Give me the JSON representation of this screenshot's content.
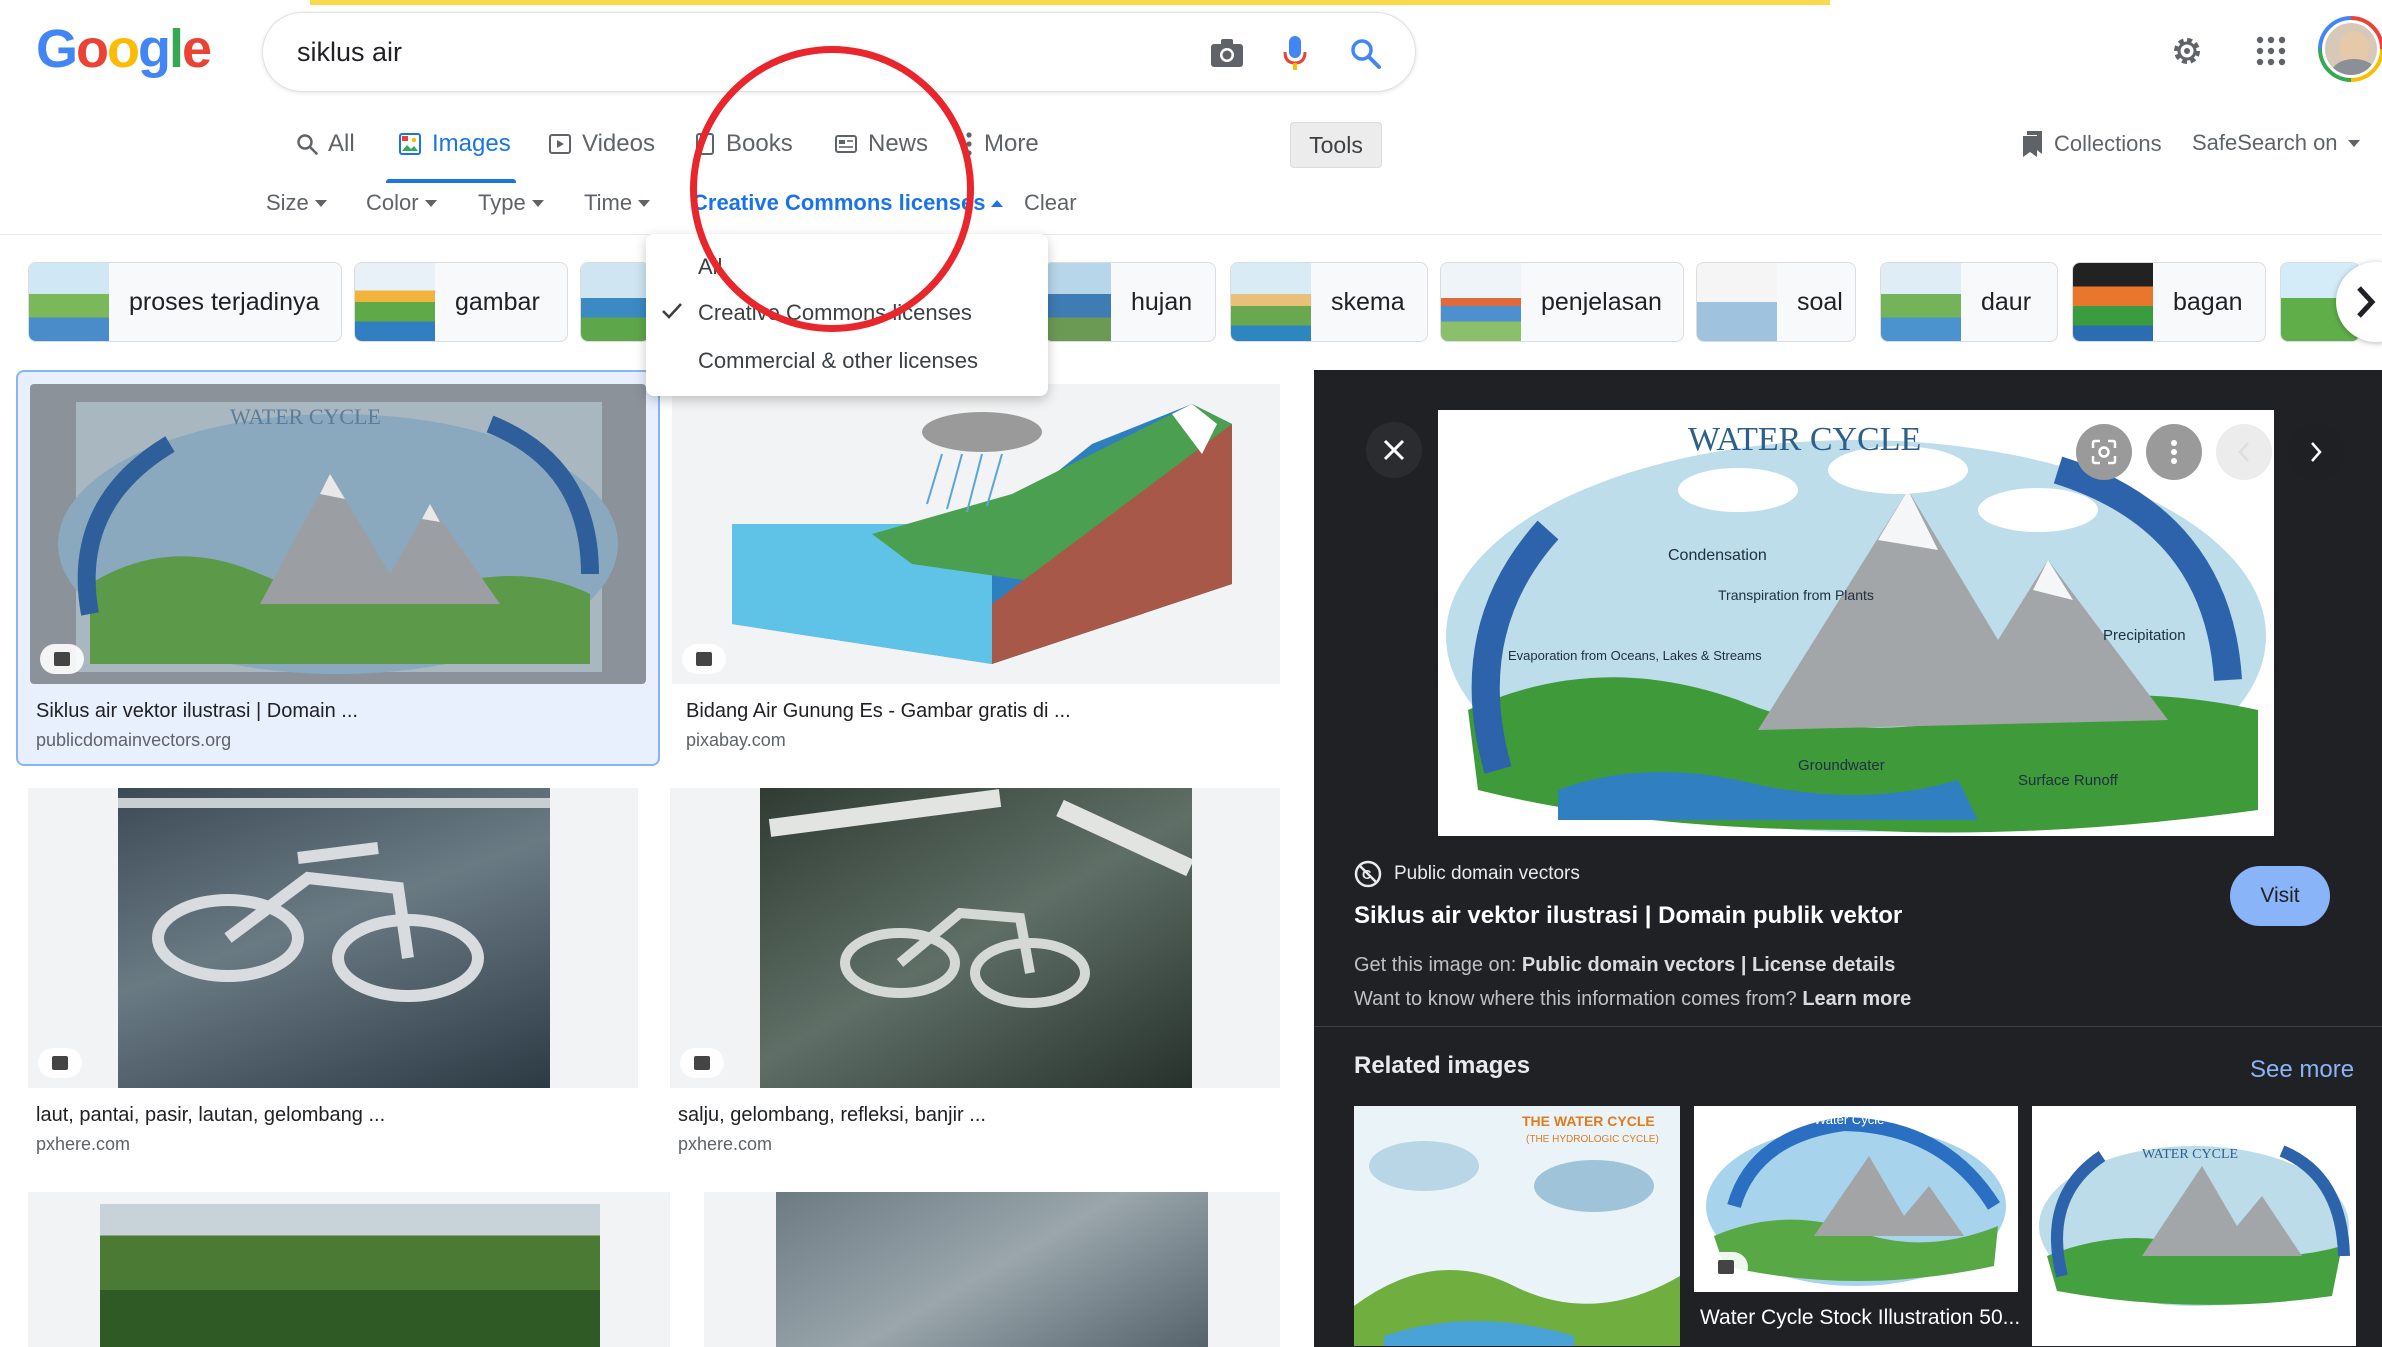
{
  "search": {
    "query": "siklus air",
    "camera_icon": "camera-icon",
    "mic_icon": "mic-icon",
    "search_icon": "search-icon"
  },
  "tabs": [
    {
      "label": "All",
      "icon": "search-icon"
    },
    {
      "label": "Images",
      "icon": "image-icon",
      "active": true
    },
    {
      "label": "Videos",
      "icon": "play-icon"
    },
    {
      "label": "Books",
      "icon": "book-icon"
    },
    {
      "label": "News",
      "icon": "news-icon"
    },
    {
      "label": "More",
      "icon": "more-vert-icon"
    }
  ],
  "tools_label": "Tools",
  "collections_label": "Collections",
  "safesearch_label": "SafeSearch on",
  "filters": {
    "size": "Size",
    "color": "Color",
    "type": "Type",
    "time": "Time",
    "license": "Creative Commons licenses",
    "clear": "Clear"
  },
  "license_dropdown": {
    "items": [
      "All",
      "Creative Commons licenses",
      "Commercial & other licenses"
    ],
    "selected": "Creative Commons licenses"
  },
  "chips": [
    "proses terjadinya",
    "gambar",
    "hujan",
    "skema",
    "penjelasan",
    "soal",
    "daur",
    "bagan"
  ],
  "results": [
    {
      "title": "Siklus air vektor ilustrasi | Domain ...",
      "source": "publicdomainvectors.org"
    },
    {
      "title": "Bidang Air Gunung Es - Gambar gratis di ...",
      "source": "pixabay.com"
    },
    {
      "title": "laut, pantai, pasir, lautan, gelombang ...",
      "source": "pxhere.com"
    },
    {
      "title": "salju, gelombang, refleksi, banjir ...",
      "source": "pxhere.com"
    }
  ],
  "image_text": {
    "water_cycle": "WATER CYCLE",
    "condensation": "Condensation",
    "transpiration": "Transpiration from Plants",
    "evaporation": "Evaporation from Oceans, Lakes & Streams",
    "precipitation": "Precipitation",
    "groundwater": "Groundwater",
    "runoff": "Surface Runoff"
  },
  "panel": {
    "source": "Public domain vectors",
    "title": "Siklus air vektor ilustrasi | Domain publik vektor",
    "visit": "Visit",
    "get_prefix": "Get this image on:",
    "get_source": "Public domain vectors",
    "license_details": "License details",
    "info_prefix": "Want to know where this information comes from?",
    "learn_more": "Learn more",
    "related_title": "Related images",
    "see_more": "See more",
    "related": [
      {
        "heading": "THE WATER CYCLE",
        "subheading": "(THE HYDROLOGIC CYCLE)"
      },
      {
        "heading": "Water Cycle",
        "caption": "Water Cycle Stock Illustration 50..."
      },
      {
        "heading": "WATER CYCLE"
      }
    ]
  },
  "colors": {
    "accent": "#1a73e8",
    "panel_bg": "#202124",
    "annotation_red": "#e8262b",
    "visit_bg": "#8ab4f8"
  }
}
